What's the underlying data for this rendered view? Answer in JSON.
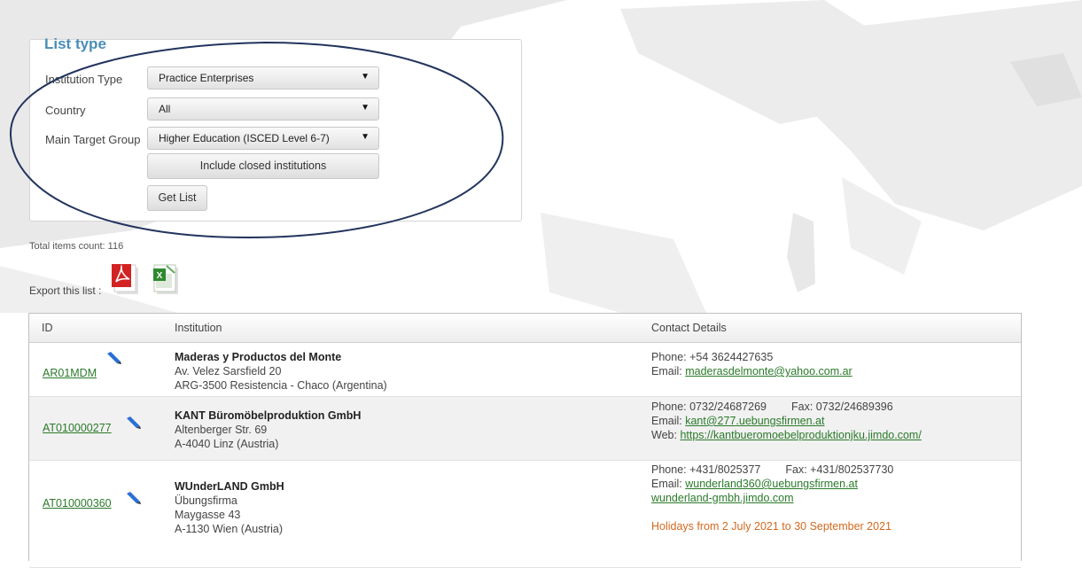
{
  "form": {
    "legend": "List type",
    "institution_type": {
      "label": "Institution Type",
      "value": "Practice Enterprises"
    },
    "country": {
      "label": "Country",
      "value": "All"
    },
    "target_group": {
      "label": "Main Target Group",
      "value": "Higher Education (ISCED Level 6-7)"
    },
    "include_closed_label": "Include closed institutions",
    "get_list_label": "Get List"
  },
  "total_text": "Total items count: 116",
  "export_label": "Export this list :",
  "export_icons": [
    "pdf-icon",
    "excel-icon"
  ],
  "table": {
    "headers": {
      "id": "ID",
      "institution": "Institution",
      "contact": "Contact Details"
    },
    "rows": [
      {
        "id": "AR01MDM",
        "name": "Maderas y Productos del Monte",
        "lines": [
          "Av. Velez Sarsfield 20",
          "ARG-3500 Resistencia - Chaco (Argentina)"
        ],
        "phone": "Phone: +54 3624427635",
        "fax": "",
        "email_label": "Email:",
        "email": "maderasdelmonte@yahoo.com.ar"
      },
      {
        "id": "AT010000277",
        "name": "KANT Büromöbelproduktion GmbH",
        "lines": [
          "Altenberger Str. 69",
          "A-4040 Linz (Austria)"
        ],
        "phone": "Phone: 0732/24687269",
        "fax": "Fax: 0732/24689396",
        "email_label": "Email:",
        "email": "kant@277.uebungsfirmen.at",
        "web_label": "Web:",
        "web": "https://kantbueromoebelproduktionjku.jimdo.com/"
      },
      {
        "id": "AT010000360",
        "name": "WUnderLAND GmbH",
        "lines": [
          "Übungsfirma",
          "Maygasse 43",
          "A-1130 Wien (Austria)"
        ],
        "phone": "Phone: +431/8025377",
        "fax": "Fax: +431/802537730",
        "email_label": "Email:",
        "email": "wunderland360@uebungsfirmen.at",
        "web": "wunderland-gmbh.jimdo.com",
        "note": "Holidays from 2 July 2021 to 30 September 2021"
      }
    ]
  },
  "colors": {
    "legend": "#4a8db7",
    "link": "#2a7a2a",
    "annotation_ellipse": "#22345e",
    "holiday_note": "#d2691e"
  }
}
